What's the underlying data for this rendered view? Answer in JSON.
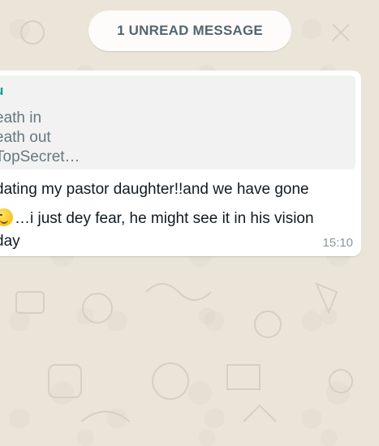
{
  "banner": {
    "unread_label": "1 UNREAD MESSAGE"
  },
  "message": {
    "quoted": {
      "sender": "u",
      "lines": [
        "eath in",
        "eath out",
        "TopSecret…"
      ]
    },
    "lines": [
      "dating my pastor daughter!!and we have gone",
      "…i just dey fear, he might see it in his vision",
      "day"
    ],
    "emoji_icon": "smirk-face-emoji",
    "time": "15:10"
  },
  "colors": {
    "wallpaper": "#ebe4d9",
    "bubble": "#ffffff",
    "quote_bg": "#f2f2f2",
    "quote_sender": "#0d9c8d",
    "time": "#8696a0"
  }
}
